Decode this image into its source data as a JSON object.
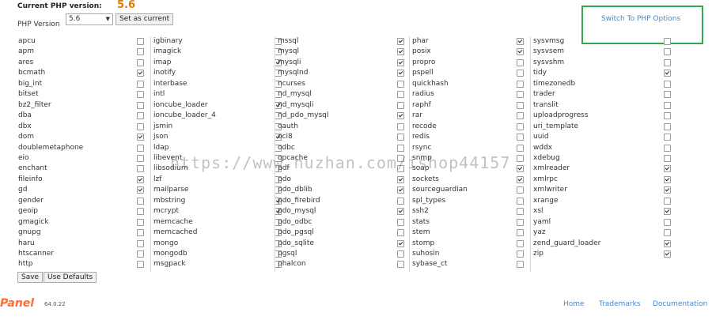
{
  "header": {
    "current_label": "Current PHP version:",
    "current_value": "5.6",
    "version_label": "PHP Version",
    "selected_version": "5.6",
    "set_button": "Set as current",
    "switch_link": "Switch To PHP Options"
  },
  "columns": [
    [
      {
        "name": "apcu",
        "checked": false
      },
      {
        "name": "apm",
        "checked": false
      },
      {
        "name": "ares",
        "checked": false
      },
      {
        "name": "bcmath",
        "checked": true
      },
      {
        "name": "big_int",
        "checked": false
      },
      {
        "name": "bitset",
        "checked": false
      },
      {
        "name": "bz2_filter",
        "checked": false
      },
      {
        "name": "dba",
        "checked": false
      },
      {
        "name": "dbx",
        "checked": false
      },
      {
        "name": "dom",
        "checked": true
      },
      {
        "name": "doublemetaphone",
        "checked": false
      },
      {
        "name": "eio",
        "checked": false
      },
      {
        "name": "enchant",
        "checked": false
      },
      {
        "name": "fileinfo",
        "checked": true
      },
      {
        "name": "gd",
        "checked": true
      },
      {
        "name": "gender",
        "checked": false
      },
      {
        "name": "geoip",
        "checked": false
      },
      {
        "name": "gmagick",
        "checked": false
      },
      {
        "name": "gnupg",
        "checked": false
      },
      {
        "name": "haru",
        "checked": false
      },
      {
        "name": "htscanner",
        "checked": false
      },
      {
        "name": "http",
        "checked": false
      }
    ],
    [
      {
        "name": "igbinary",
        "checked": false
      },
      {
        "name": "imagick",
        "checked": false
      },
      {
        "name": "imap",
        "checked": true
      },
      {
        "name": "inotify",
        "checked": false
      },
      {
        "name": "interbase",
        "checked": false
      },
      {
        "name": "intl",
        "checked": false
      },
      {
        "name": "ioncube_loader",
        "checked": true
      },
      {
        "name": "ioncube_loader_4",
        "checked": false
      },
      {
        "name": "jsmin",
        "checked": false
      },
      {
        "name": "json",
        "checked": true
      },
      {
        "name": "ldap",
        "checked": false
      },
      {
        "name": "libevent",
        "checked": false
      },
      {
        "name": "libsodium",
        "checked": false
      },
      {
        "name": "lzf",
        "checked": false
      },
      {
        "name": "mailparse",
        "checked": false
      },
      {
        "name": "mbstring",
        "checked": true
      },
      {
        "name": "mcrypt",
        "checked": true
      },
      {
        "name": "memcache",
        "checked": false
      },
      {
        "name": "memcached",
        "checked": false
      },
      {
        "name": "mongo",
        "checked": false
      },
      {
        "name": "mongodb",
        "checked": false
      },
      {
        "name": "msgpack",
        "checked": false
      }
    ],
    [
      {
        "name": "mssql",
        "checked": true
      },
      {
        "name": "mysql",
        "checked": true
      },
      {
        "name": "mysqli",
        "checked": true
      },
      {
        "name": "mysqlnd",
        "checked": true
      },
      {
        "name": "ncurses",
        "checked": false
      },
      {
        "name": "nd_mysql",
        "checked": false
      },
      {
        "name": "nd_mysqli",
        "checked": false
      },
      {
        "name": "nd_pdo_mysql",
        "checked": true
      },
      {
        "name": "oauth",
        "checked": false
      },
      {
        "name": "oci8",
        "checked": false
      },
      {
        "name": "odbc",
        "checked": false
      },
      {
        "name": "opcache",
        "checked": false
      },
      {
        "name": "pdf",
        "checked": false
      },
      {
        "name": "pdo",
        "checked": true
      },
      {
        "name": "pdo_dblib",
        "checked": true
      },
      {
        "name": "pdo_firebird",
        "checked": false
      },
      {
        "name": "pdo_mysql",
        "checked": true
      },
      {
        "name": "pdo_odbc",
        "checked": false
      },
      {
        "name": "pdo_pgsql",
        "checked": false
      },
      {
        "name": "pdo_sqlite",
        "checked": true
      },
      {
        "name": "pgsql",
        "checked": false
      },
      {
        "name": "phalcon",
        "checked": false
      }
    ],
    [
      {
        "name": "phar",
        "checked": true
      },
      {
        "name": "posix",
        "checked": true
      },
      {
        "name": "propro",
        "checked": false
      },
      {
        "name": "pspell",
        "checked": false
      },
      {
        "name": "quickhash",
        "checked": false
      },
      {
        "name": "radius",
        "checked": false
      },
      {
        "name": "raphf",
        "checked": false
      },
      {
        "name": "rar",
        "checked": false
      },
      {
        "name": "recode",
        "checked": false
      },
      {
        "name": "redis",
        "checked": false
      },
      {
        "name": "rsync",
        "checked": false
      },
      {
        "name": "snmp",
        "checked": false
      },
      {
        "name": "soap",
        "checked": true
      },
      {
        "name": "sockets",
        "checked": true
      },
      {
        "name": "sourceguardian",
        "checked": false
      },
      {
        "name": "spl_types",
        "checked": false
      },
      {
        "name": "ssh2",
        "checked": false
      },
      {
        "name": "stats",
        "checked": false
      },
      {
        "name": "stem",
        "checked": false
      },
      {
        "name": "stomp",
        "checked": false
      },
      {
        "name": "suhosin",
        "checked": false
      },
      {
        "name": "sybase_ct",
        "checked": false
      }
    ],
    [
      {
        "name": "sysvmsg",
        "checked": false
      },
      {
        "name": "sysvsem",
        "checked": false
      },
      {
        "name": "sysvshm",
        "checked": false
      },
      {
        "name": "tidy",
        "checked": true
      },
      {
        "name": "timezonedb",
        "checked": false
      },
      {
        "name": "trader",
        "checked": false
      },
      {
        "name": "translit",
        "checked": false
      },
      {
        "name": "uploadprogress",
        "checked": false
      },
      {
        "name": "uri_template",
        "checked": false
      },
      {
        "name": "uuid",
        "checked": false
      },
      {
        "name": "wddx",
        "checked": false
      },
      {
        "name": "xdebug",
        "checked": false
      },
      {
        "name": "xmlreader",
        "checked": true
      },
      {
        "name": "xmlrpc",
        "checked": true
      },
      {
        "name": "xmlwriter",
        "checked": true
      },
      {
        "name": "xrange",
        "checked": false
      },
      {
        "name": "xsl",
        "checked": true
      },
      {
        "name": "yaml",
        "checked": false
      },
      {
        "name": "yaz",
        "checked": false
      },
      {
        "name": "zend_guard_loader",
        "checked": true
      },
      {
        "name": "zip",
        "checked": true
      }
    ]
  ],
  "buttons": {
    "save": "Save",
    "defaults": "Use Defaults"
  },
  "watermark": "https://www.huzhan.com/ishop44157",
  "footer": {
    "logo": "Panel",
    "version": "64.0.22",
    "links": [
      "Home",
      "Trademarks",
      "Documentation"
    ]
  }
}
